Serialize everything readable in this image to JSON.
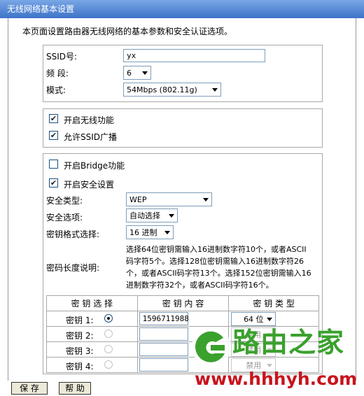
{
  "window": {
    "title": "无线网络基本设置"
  },
  "intro": "本页面设置路由器无线网络的基本参数和安全认证选项。",
  "basic": {
    "ssid_label": "SSID号:",
    "ssid_value": "yx",
    "channel_label": "频 段:",
    "channel_value": "6",
    "mode_label": "模式:",
    "mode_value": "54Mbps (802.11g)"
  },
  "options": {
    "enable_wireless_label": "开启无线功能",
    "enable_wireless_checked": true,
    "broadcast_ssid_label": "允许SSID广播",
    "broadcast_ssid_checked": true
  },
  "security": {
    "bridge_label": "开启Bridge功能",
    "bridge_checked": false,
    "enable_security_label": "开启安全设置",
    "enable_security_checked": true,
    "type_label": "安全类型:",
    "type_value": "WEP",
    "option_label": "安全选项:",
    "option_value": "自动选择",
    "key_format_label": "密钥格式选择:",
    "key_format_value": "16 进制",
    "key_length_label": "密码长度说明:",
    "key_length_note_1": "选择64位密钥需输入16进制数字符10个，或者ASCII",
    "key_length_note_2": "码字符5个。选择128位密钥需输入16进制数字符26",
    "key_length_note_3": "个，或者ASCII码字符13个。选择152位密钥需输入16",
    "key_length_note_4": "进制数字符32个，或者ASCII码字符16个。"
  },
  "keys_table": {
    "headers": [
      "密 钥 选 择",
      "密 钥 内 容",
      "密 钥 类 型"
    ],
    "rows": [
      {
        "label": "密钥 1:",
        "selected": true,
        "value": "1596711988",
        "type": "64 位"
      },
      {
        "label": "密钥 2:",
        "selected": false,
        "value": "",
        "type": "禁用"
      },
      {
        "label": "密钥 3:",
        "selected": false,
        "value": "",
        "type": "禁用"
      },
      {
        "label": "密钥 4:",
        "selected": false,
        "value": "",
        "type": "禁用"
      }
    ]
  },
  "buttons": {
    "save": "保 存",
    "help": "帮 助"
  },
  "watermark": {
    "brand": "路由之家",
    "url": "www.hhhyh.com"
  },
  "colors": {
    "titlebar": "#3d73c8",
    "watermark_green": "#3aa12d",
    "watermark_red": "#c8141d"
  }
}
